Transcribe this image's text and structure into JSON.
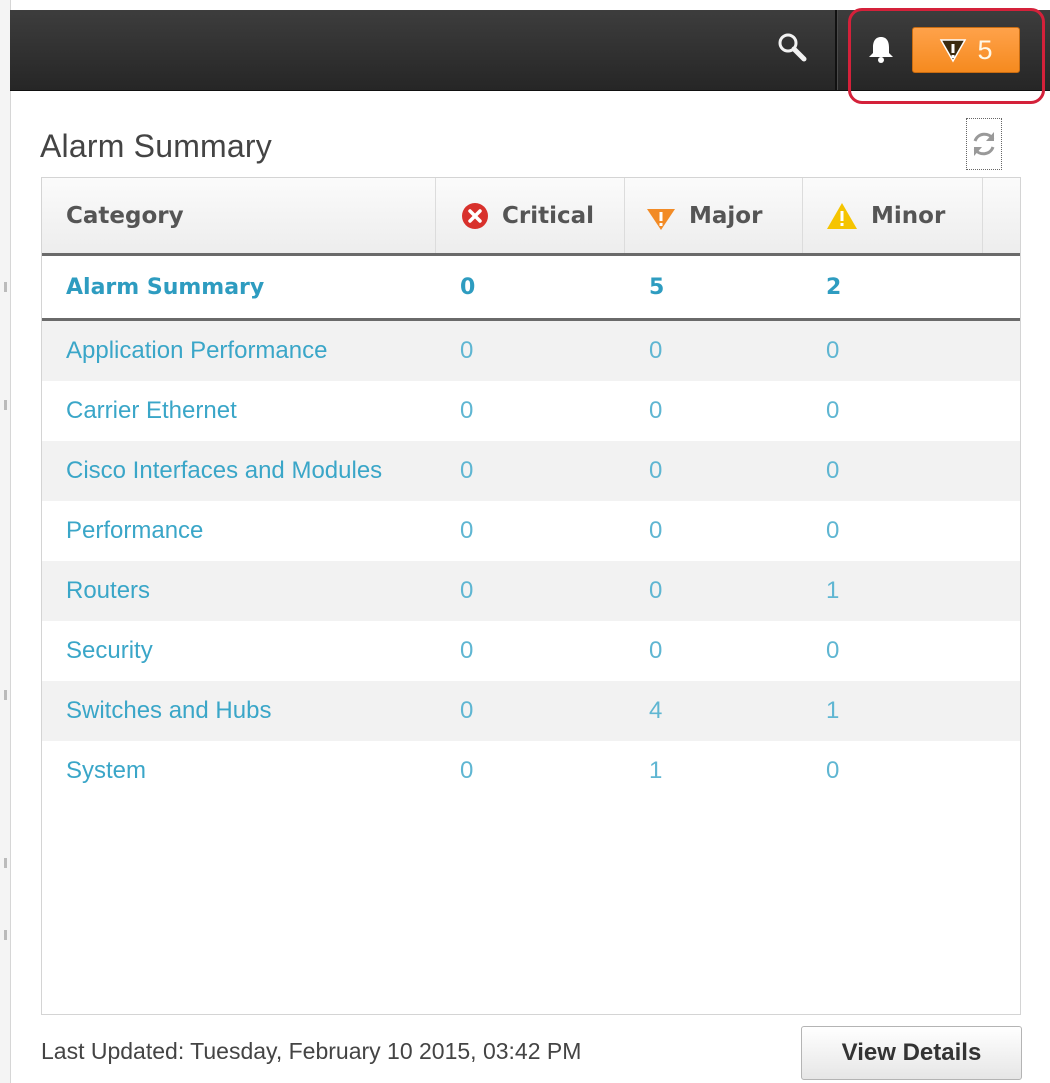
{
  "header": {
    "alarm_count": "5",
    "icons": {
      "search": "search-icon",
      "bell": "bell-icon",
      "alarm": "major-alarm-icon"
    },
    "badge_color": "#f58a1f",
    "highlight_color": "#d4213a"
  },
  "panel": {
    "title": "Alarm Summary",
    "refresh_icon": "refresh-icon"
  },
  "table": {
    "columns": [
      "Category",
      "Critical",
      "Major",
      "Minor"
    ],
    "column_icons": [
      "",
      "critical-icon",
      "major-icon",
      "minor-icon"
    ],
    "summary": {
      "category": "Alarm Summary",
      "critical": "0",
      "major": "5",
      "minor": "2"
    },
    "rows": [
      {
        "category": "Application Performance",
        "critical": "0",
        "major": "0",
        "minor": "0"
      },
      {
        "category": "Carrier Ethernet",
        "critical": "0",
        "major": "0",
        "minor": "0"
      },
      {
        "category": "Cisco Interfaces and Modules",
        "critical": "0",
        "major": "0",
        "minor": "0"
      },
      {
        "category": "Performance",
        "critical": "0",
        "major": "0",
        "minor": "0"
      },
      {
        "category": "Routers",
        "critical": "0",
        "major": "0",
        "minor": "1"
      },
      {
        "category": "Security",
        "critical": "0",
        "major": "0",
        "minor": "0"
      },
      {
        "category": "Switches and Hubs",
        "critical": "0",
        "major": "4",
        "minor": "1"
      },
      {
        "category": "System",
        "critical": "0",
        "major": "1",
        "minor": "0"
      }
    ],
    "link_color": "#2f9fc2"
  },
  "footer": {
    "last_updated": "Last Updated: Tuesday, February 10 2015, 03:42 PM",
    "view_details_label": "View Details"
  }
}
